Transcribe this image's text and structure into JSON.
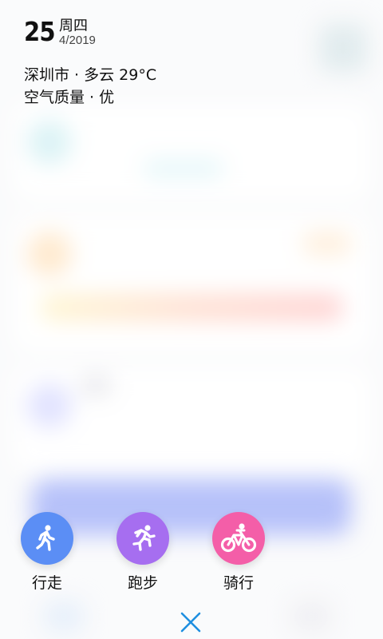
{
  "header": {
    "day": "25",
    "weekday": "周四",
    "date": "4/2019",
    "weather": "深圳市 · 多云 29°C",
    "air_quality": "空气质量 · 优"
  },
  "actions": [
    {
      "label": "行走",
      "icon": "walk-icon",
      "color": "#5b8ef5"
    },
    {
      "label": "跑步",
      "icon": "run-icon",
      "color": "#a66ef0"
    },
    {
      "label": "骑行",
      "icon": "bike-icon",
      "color": "#f45ea8"
    }
  ],
  "close": {
    "icon": "close-icon",
    "color": "#1f8fe0"
  }
}
